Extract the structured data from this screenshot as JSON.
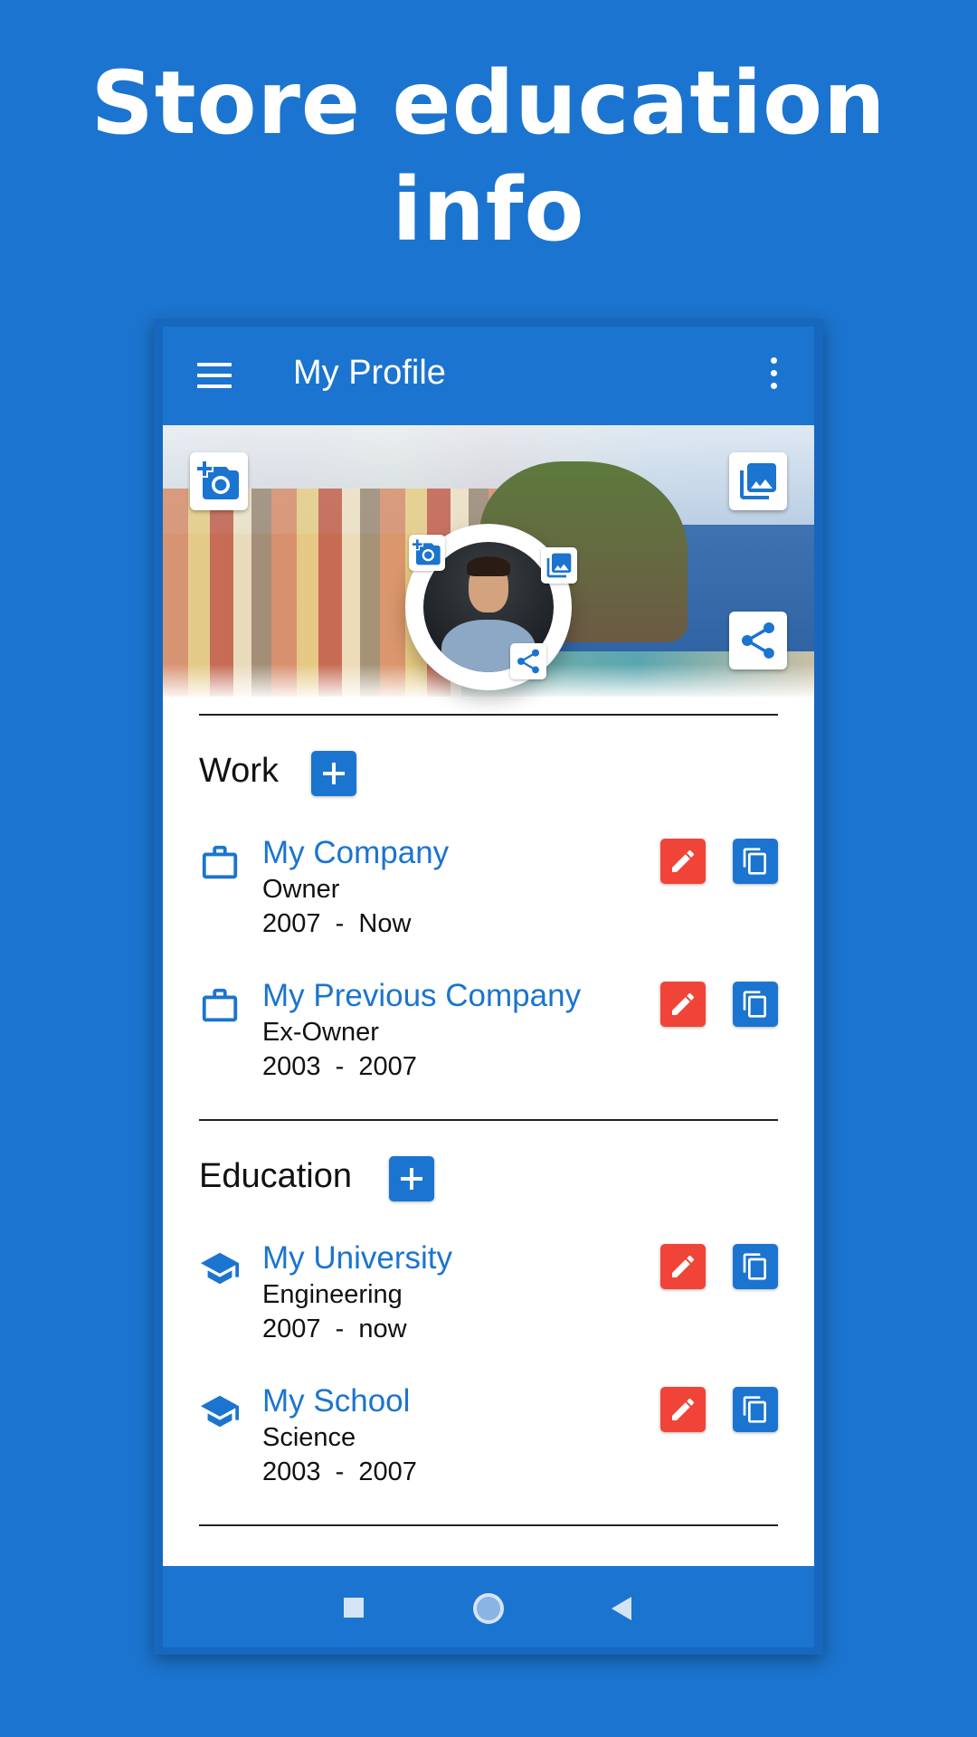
{
  "headline": {
    "line1": "Store education",
    "line2": "info"
  },
  "appbar": {
    "title": "My Profile"
  },
  "work": {
    "title": "Work",
    "items": [
      {
        "name": "My Company",
        "role": "Owner",
        "dates": "2007  -  Now"
      },
      {
        "name": "My Previous Company",
        "role": "Ex-Owner",
        "dates": "2003  -  2007"
      }
    ]
  },
  "education": {
    "title": "Education",
    "items": [
      {
        "name": "My University",
        "role": "Engineering",
        "dates": "2007  -  now"
      },
      {
        "name": "My School",
        "role": "Science",
        "dates": "2003  -  2007"
      }
    ]
  },
  "colors": {
    "accent": "#1b74cf",
    "edit": "#f04438",
    "background": "#1b74cf"
  },
  "icons": {
    "menu": "menu-icon",
    "more": "more-vert-icon",
    "add_photo": "add-photo-icon",
    "gallery": "gallery-icon",
    "share": "share-icon",
    "briefcase": "briefcase-icon",
    "school": "graduation-cap-icon",
    "edit": "pencil-icon",
    "copy": "copy-icon"
  }
}
